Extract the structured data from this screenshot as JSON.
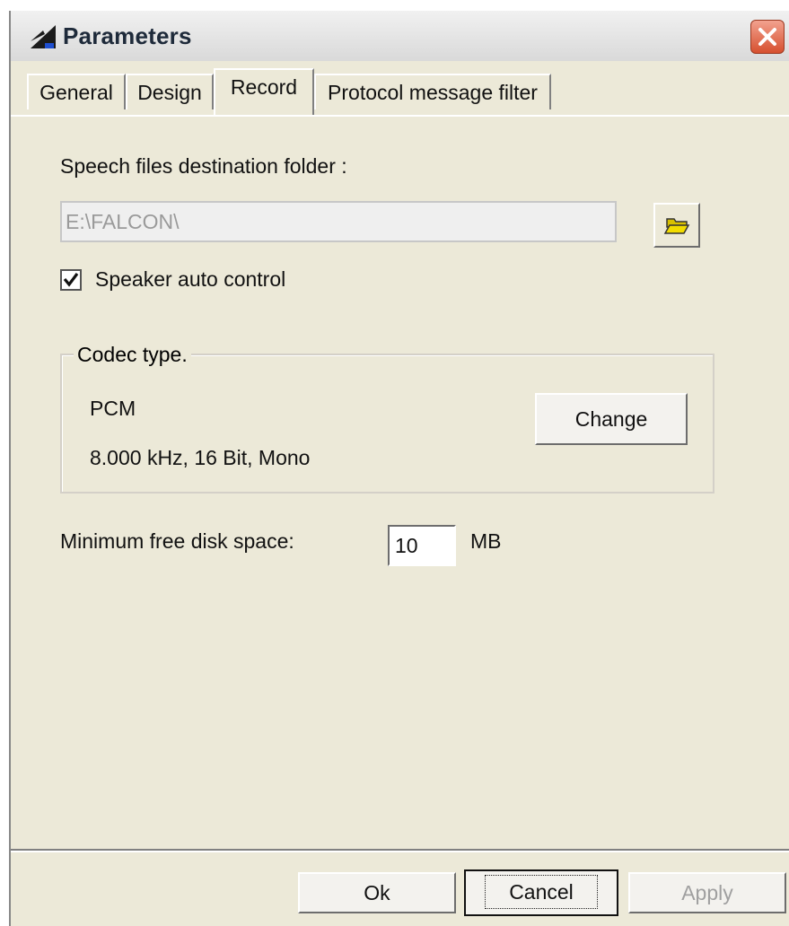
{
  "window": {
    "title": "Parameters"
  },
  "tabs": [
    {
      "label": "General"
    },
    {
      "label": "Design"
    },
    {
      "label": "Record"
    },
    {
      "label": "Protocol message filter"
    }
  ],
  "record": {
    "folder_label": "Speech files destination folder :",
    "folder_value": "E:\\FALCON\\",
    "speaker_label": "Speaker auto control",
    "speaker_checked": true,
    "codec_group_label": "Codec type.",
    "codec_name": "PCM",
    "codec_format": "8.000 kHz, 16 Bit, Mono",
    "change_label": "Change",
    "min_disk_label": "Minimum free disk space:",
    "min_disk_value": "10",
    "min_disk_unit": "MB"
  },
  "footer": {
    "ok_label": "Ok",
    "cancel_label": "Cancel",
    "apply_label": "Apply"
  },
  "icons": {
    "app": "parameters-app-icon",
    "close": "close-icon",
    "browse": "folder-open-icon",
    "check": "checkmark-icon"
  }
}
